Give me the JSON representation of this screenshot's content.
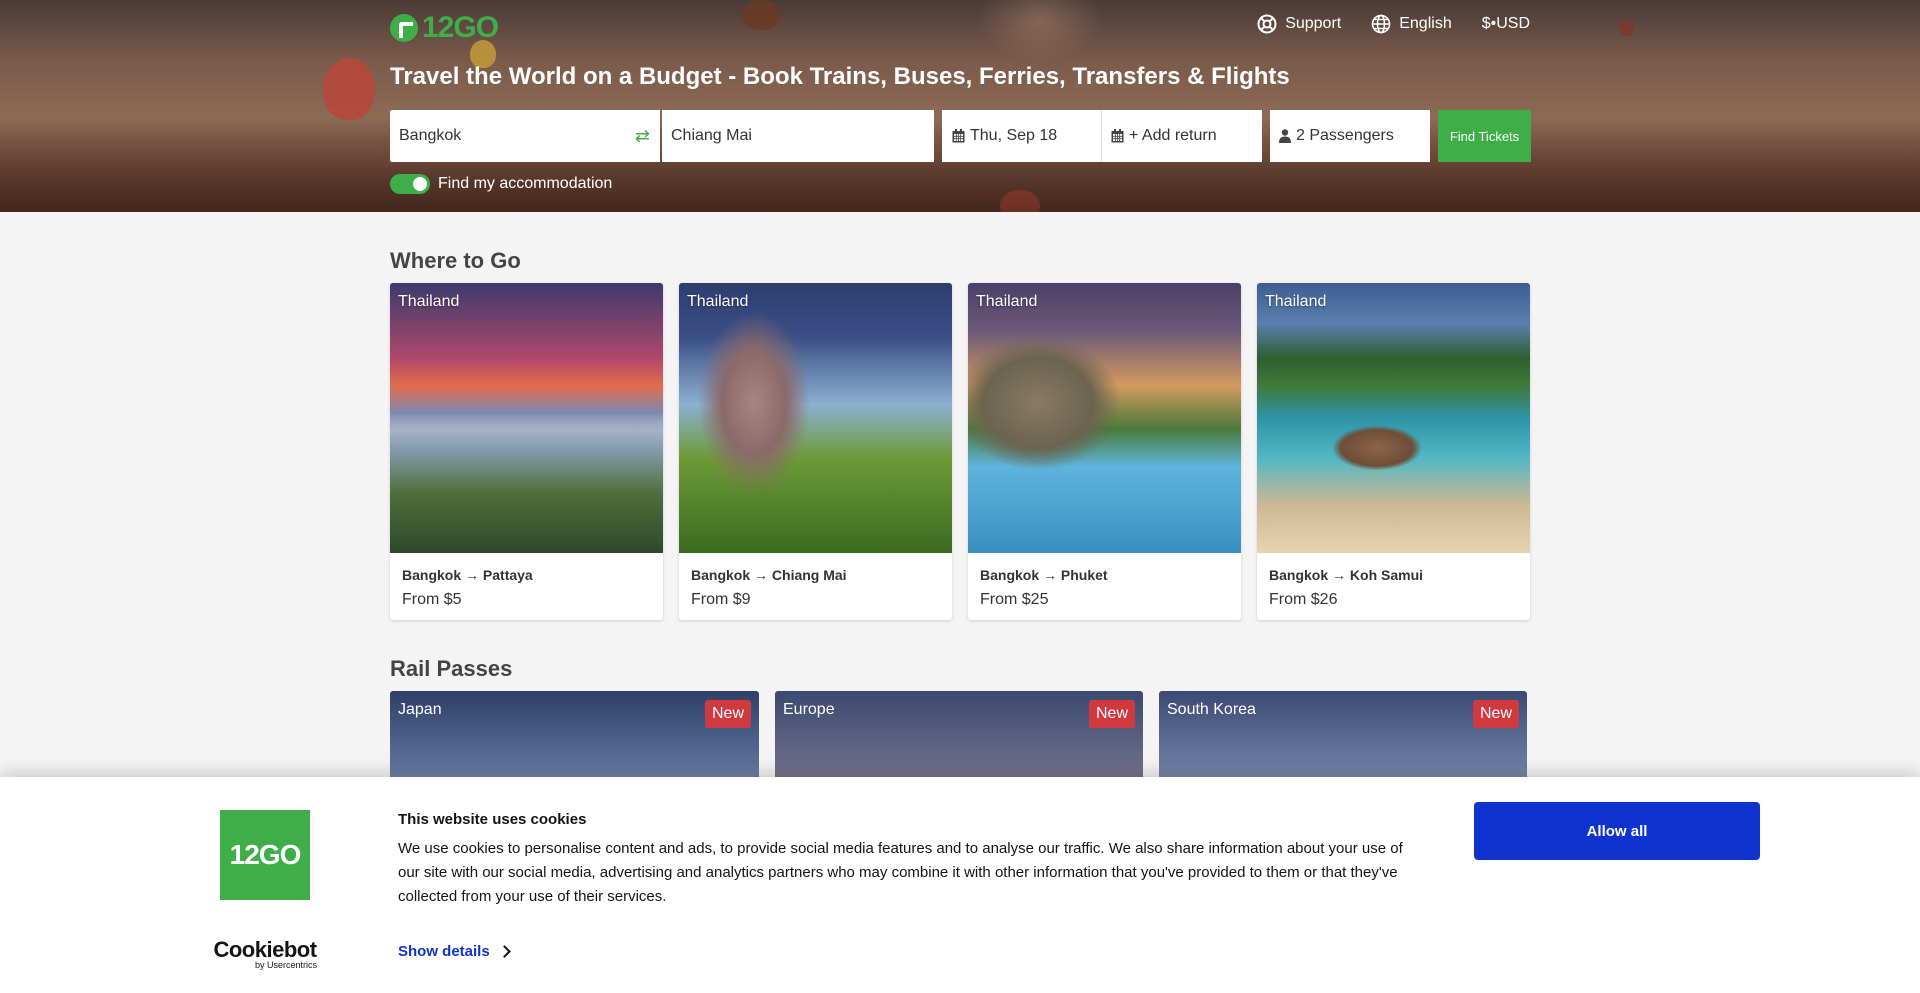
{
  "brand": {
    "logo_text": "12GO"
  },
  "nav": {
    "support": "Support",
    "language": "English",
    "currency": "$•USD"
  },
  "hero": {
    "headline": "Travel the World on a Budget - Book Trains, Buses, Ferries, Transfers & Flights"
  },
  "search": {
    "from": "Bangkok",
    "to": "Chiang Mai",
    "date": "Thu, Sep 18",
    "return": "+ Add return",
    "passengers": "2 Passengers",
    "find_button": "Find Tickets",
    "accommodation_label": "Find my accommodation"
  },
  "where_to_go": {
    "title": "Where to Go",
    "cards": [
      {
        "country": "Thailand",
        "from": "Bangkok",
        "to": "Pattaya",
        "price": "From $5"
      },
      {
        "country": "Thailand",
        "from": "Bangkok",
        "to": "Chiang Mai",
        "price": "From $9"
      },
      {
        "country": "Thailand",
        "from": "Bangkok",
        "to": "Phuket",
        "price": "From $25"
      },
      {
        "country": "Thailand",
        "from": "Bangkok",
        "to": "Koh Samui",
        "price": "From $26"
      }
    ]
  },
  "rail_passes": {
    "title": "Rail Passes",
    "items": [
      {
        "country": "Japan",
        "badge": "New"
      },
      {
        "country": "Europe",
        "badge": "New"
      },
      {
        "country": "South Korea",
        "badge": "New"
      }
    ]
  },
  "cookie": {
    "logo_text": "12GO",
    "brand_main": "Cookiebot",
    "brand_sub": "by Usercentrics",
    "title": "This website uses cookies",
    "text": "We use cookies to personalise content and ads, to provide social media features and to analyse our traffic. We also share information about your use of our site with our social media, advertising and analytics partners who may combine it with other information that you've provided to them or that they've collected from your use of their services.",
    "details_label": "Show details",
    "allow_label": "Allow all"
  },
  "colors": {
    "brand_green": "#3fae49",
    "badge_red": "#d0393e",
    "cookie_blue": "#1032cf"
  }
}
